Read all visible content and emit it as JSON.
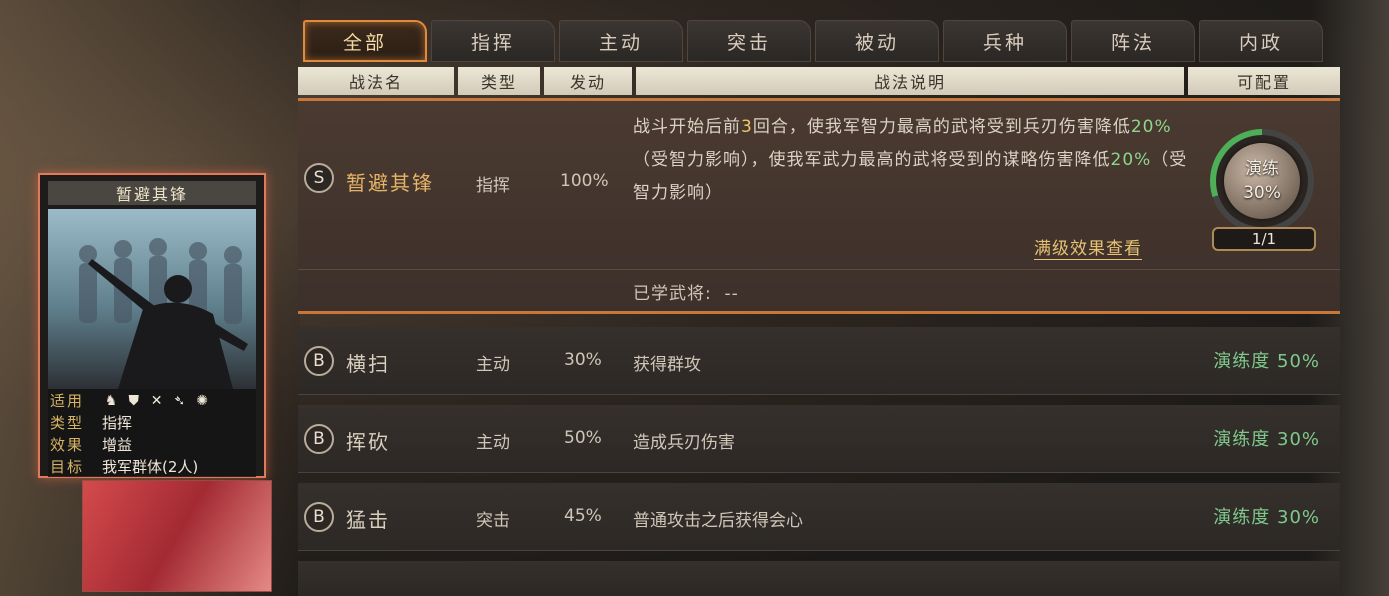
{
  "tabs": [
    {
      "label": "全部",
      "active": true
    },
    {
      "label": "指挥"
    },
    {
      "label": "主动"
    },
    {
      "label": "突击"
    },
    {
      "label": "被动"
    },
    {
      "label": "兵种"
    },
    {
      "label": "阵法"
    },
    {
      "label": "内政"
    }
  ],
  "header": {
    "name": "战法名",
    "type": "类型",
    "rate": "发动",
    "desc": "战法说明",
    "config": "可配置"
  },
  "featured": {
    "grade": "S",
    "name": "暂避其锋",
    "type": "指挥",
    "rate": "100%",
    "desc_parts": {
      "p1": "战斗开始后前",
      "n1": "3",
      "p2": "回合，使我军智力最高的武将受到兵刃伤害降低",
      "n2": "20%",
      "p3": "（受智力影响），使我军武力最高的武将受到的谋略伤害降低",
      "n3": "20%",
      "p4": "（受智力影响）"
    },
    "full_effect_link": "满级效果查看",
    "learned_label": "已学武将:",
    "learned_value": "--",
    "practice_label": "演练",
    "practice_value": "30%",
    "practice_fraction": 0.3,
    "counter": "1/1"
  },
  "rows": [
    {
      "grade": "B",
      "name": "横扫",
      "type": "主动",
      "rate": "30%",
      "desc": "获得群攻",
      "progress": "演练度 50%"
    },
    {
      "grade": "B",
      "name": "挥砍",
      "type": "主动",
      "rate": "50%",
      "desc": "造成兵刃伤害",
      "progress": "演练度 30%"
    },
    {
      "grade": "B",
      "name": "猛击",
      "type": "突击",
      "rate": "45%",
      "desc": "普通攻击之后获得会心",
      "progress": "演练度 30%"
    }
  ],
  "card": {
    "title": "暂避其锋",
    "apply_label": "适用",
    "apply_icons": [
      "cavalry-icon",
      "shield-icon",
      "crossbow-icon",
      "spear-icon",
      "wheel-icon"
    ],
    "type_label": "类型",
    "type_value": "指挥",
    "effect_label": "效果",
    "effect_value": "增益",
    "target_label": "目标",
    "target_value": "我军群体(2人)"
  },
  "colors": {
    "accent": "#e08a3a",
    "highlight_green": "#8fd58a",
    "highlight_gold": "#e8c274"
  }
}
